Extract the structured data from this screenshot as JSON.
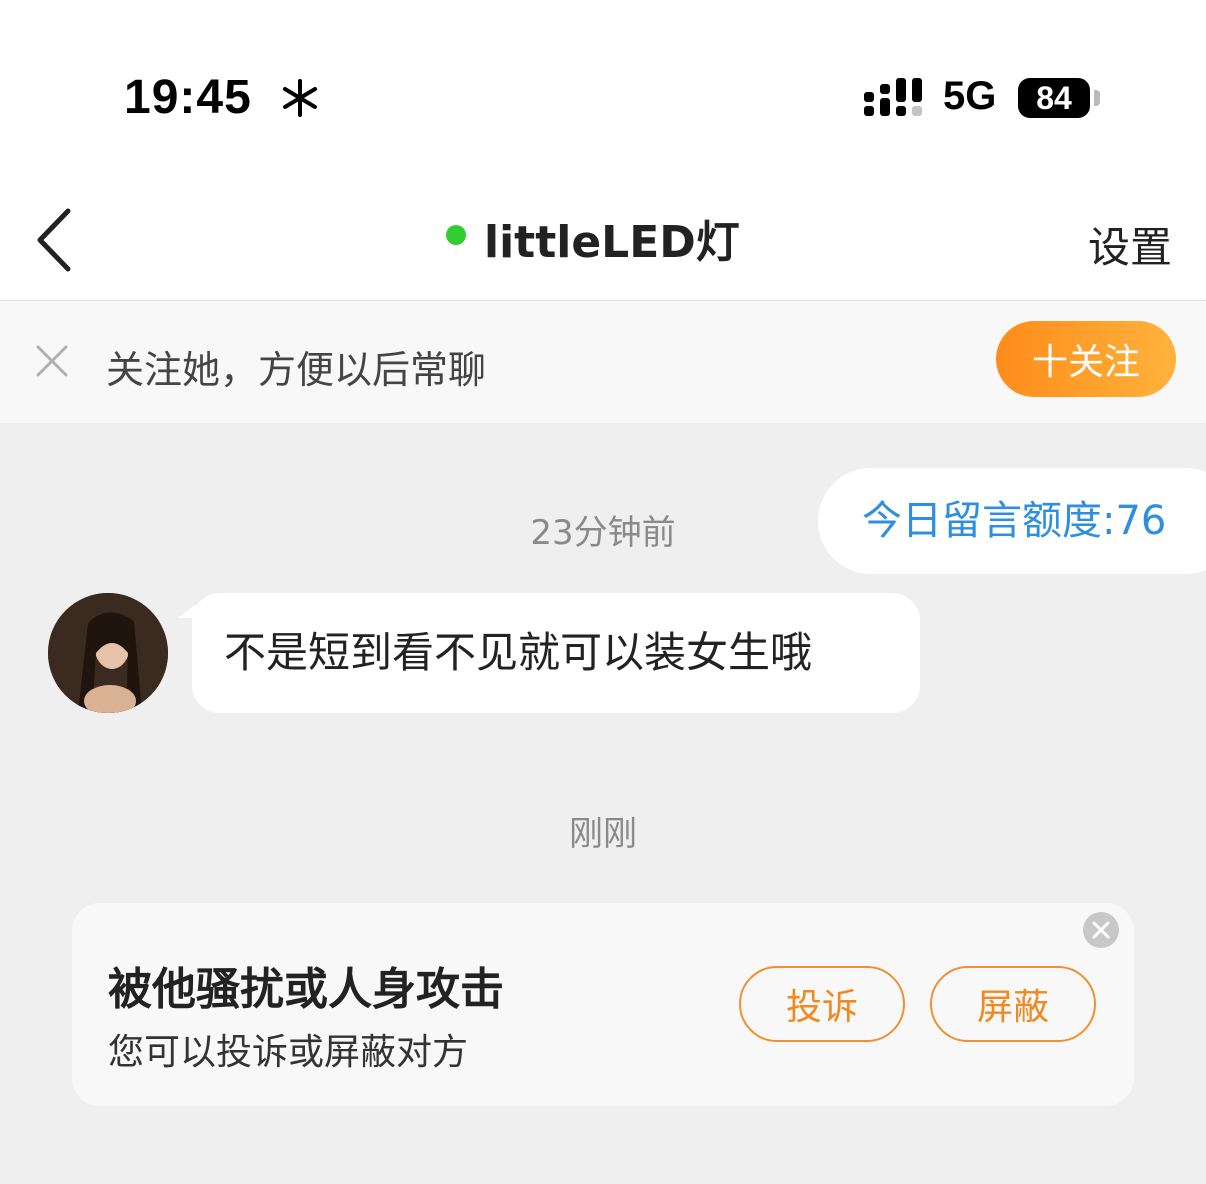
{
  "status_bar": {
    "time": "19:45",
    "network": "5G",
    "battery": "84"
  },
  "header": {
    "title": "littleLED灯",
    "settings_label": "设置"
  },
  "follow_bar": {
    "text": "关注她，方便以后常聊",
    "button_label": "十关注"
  },
  "chat": {
    "quota_label": "今日留言额度:76",
    "messages": [
      {
        "time": "23分钟前",
        "text": "不是短到看不见就可以装女生哦"
      }
    ],
    "second_timestamp": "刚刚"
  },
  "report_card": {
    "title": "被他骚扰或人身攻击",
    "subtitle": "您可以投诉或屏蔽对方",
    "report_label": "投诉",
    "block_label": "屏蔽"
  },
  "colors": {
    "accent_orange": "#ff9a26",
    "quota_blue": "#2e8fe0",
    "online_green": "#33cc33"
  }
}
